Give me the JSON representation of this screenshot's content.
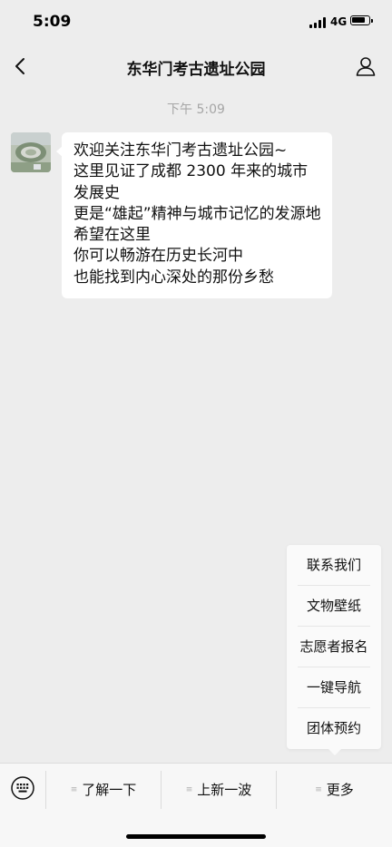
{
  "status_bar": {
    "time": "5:09",
    "network": "4G"
  },
  "nav": {
    "title": "东华门考古遗址公园"
  },
  "chat": {
    "timestamp": "下午 5:09",
    "message_lines": [
      "欢迎关注东华门考古遗址公园~",
      "这里见证了成都 2300 年来的城市发展史",
      "更是“雄起”精神与城市记忆的发源地",
      "希望在这里",
      "你可以畅游在历史长河中",
      "也能找到内心深处的那份乡愁"
    ]
  },
  "popup_menu": {
    "items": [
      "联系我们",
      "文物壁纸",
      "志愿者报名",
      "一键导航",
      "团体预约"
    ]
  },
  "bottom_menu": {
    "items": [
      "了解一下",
      "上新一波",
      "更多"
    ]
  }
}
